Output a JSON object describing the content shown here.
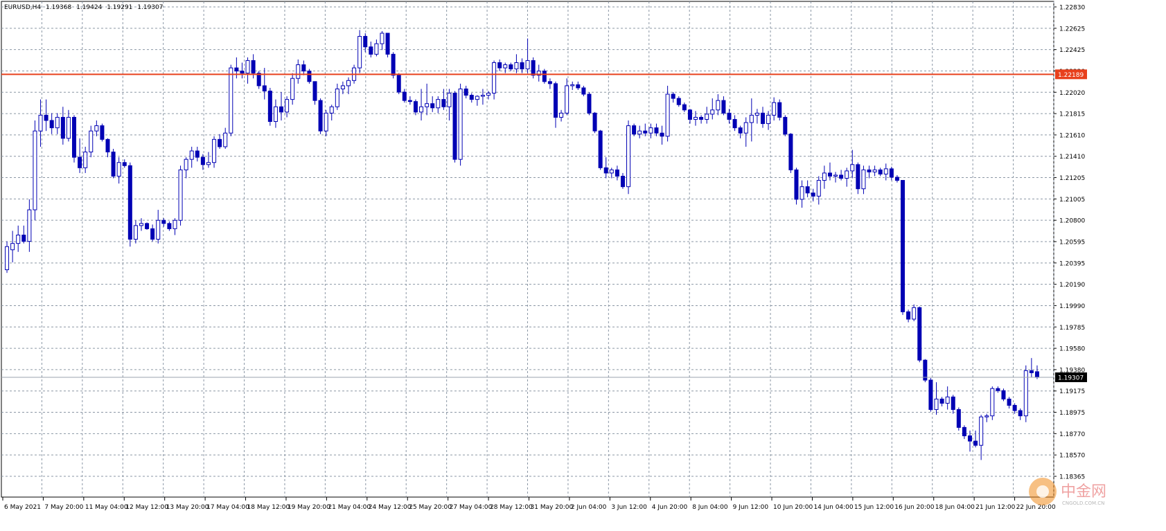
{
  "chart_data": {
    "type": "candlestick",
    "symbol": "EURUSD,H4",
    "ohlc_header": [
      "1.19368",
      "1.19424",
      "1.19291",
      "1.19307"
    ],
    "grid": true,
    "colors": {
      "candle": "#0000b4",
      "grid": "#8a96a4",
      "resistance_line": "#e8401c",
      "current_price_line": "#9aa2ac",
      "label_bg": "#000000",
      "axis_text": "#000000"
    },
    "ylim": [
      1.18365,
      1.2283
    ],
    "y_ticks": [
      "1.22830",
      "1.22625",
      "1.22425",
      "1.22220",
      "1.22020",
      "1.21815",
      "1.21610",
      "1.21410",
      "1.21205",
      "1.21005",
      "1.20800",
      "1.20595",
      "1.20395",
      "1.20190",
      "1.19990",
      "1.19785",
      "1.19580",
      "1.19380",
      "1.19175",
      "1.18975",
      "1.18770",
      "1.18570",
      "1.18365"
    ],
    "x_labels": [
      "6 May 2021",
      "7 May 20:00",
      "11 May 04:00",
      "12 May 12:00",
      "13 May 20:00",
      "17 May 04:00",
      "18 May 12:00",
      "19 May 20:00",
      "21 May 04:00",
      "24 May 12:00",
      "25 May 20:00",
      "27 May 04:00",
      "28 May 12:00",
      "31 May 20:00",
      "2 Jun 04:00",
      "3 Jun 12:00",
      "4 Jun 20:00",
      "8 Jun 04:00",
      "9 Jun 12:00",
      "10 Jun 20:00",
      "14 Jun 04:00",
      "15 Jun 12:00",
      "16 Jun 20:00",
      "18 Jun 04:00",
      "21 Jun 12:00",
      "22 Jun 20:00"
    ],
    "horizontal_line": {
      "price": 1.22189,
      "label": "1.22189"
    },
    "current_price": {
      "price": 1.19307,
      "label": "1.19307"
    },
    "candles": [
      [
        1.2033,
        1.206,
        1.203,
        1.2055
      ],
      [
        1.2052,
        1.207,
        1.204,
        1.2058
      ],
      [
        1.2058,
        1.2075,
        1.205,
        1.2066
      ],
      [
        1.2066,
        1.2075,
        1.2058,
        1.206
      ],
      [
        1.206,
        1.21,
        1.205,
        1.209
      ],
      [
        1.209,
        1.2175,
        1.208,
        1.2165
      ],
      [
        1.2165,
        1.2195,
        1.215,
        1.218
      ],
      [
        1.218,
        1.2195,
        1.2165,
        1.2175
      ],
      [
        1.2175,
        1.2182,
        1.2162,
        1.2168
      ],
      [
        1.2168,
        1.2182,
        1.2162,
        1.2178
      ],
      [
        1.2178,
        1.2188,
        1.2152,
        1.2158
      ],
      [
        1.2158,
        1.2185,
        1.2155,
        1.2178
      ],
      [
        1.2178,
        1.218,
        1.2135,
        1.214
      ],
      [
        1.214,
        1.2158,
        1.2125,
        1.213
      ],
      [
        1.213,
        1.215,
        1.2125,
        1.2145
      ],
      [
        1.2145,
        1.217,
        1.214,
        1.2165
      ],
      [
        1.2165,
        1.2175,
        1.216,
        1.217
      ],
      [
        1.217,
        1.2172,
        1.2155,
        1.2157
      ],
      [
        1.2157,
        1.2158,
        1.214,
        1.2145
      ],
      [
        1.2145,
        1.2148,
        1.212,
        1.2122
      ],
      [
        1.2122,
        1.214,
        1.2115,
        1.2135
      ],
      [
        1.2135,
        1.2138,
        1.213,
        1.2132
      ],
      [
        1.2132,
        1.2135,
        1.2055,
        1.2062
      ],
      [
        1.2062,
        1.208,
        1.2058,
        1.2075
      ],
      [
        1.2075,
        1.2082,
        1.207,
        1.2077
      ],
      [
        1.2077,
        1.2078,
        1.2071,
        1.2072
      ],
      [
        1.2072,
        1.2076,
        1.206,
        1.2062
      ],
      [
        1.2062,
        1.209,
        1.2058,
        1.208
      ],
      [
        1.208,
        1.2082,
        1.2074,
        1.2077
      ],
      [
        1.2077,
        1.2079,
        1.207,
        1.2072
      ],
      [
        1.2072,
        1.2082,
        1.2066,
        1.208
      ],
      [
        1.208,
        1.2132,
        1.2075,
        1.2128
      ],
      [
        1.2128,
        1.214,
        1.212,
        1.2138
      ],
      [
        1.2138,
        1.215,
        1.213,
        1.2146
      ],
      [
        1.2146,
        1.215,
        1.2136,
        1.214
      ],
      [
        1.214,
        1.2143,
        1.2128,
        1.2133
      ],
      [
        1.2133,
        1.2145,
        1.213,
        1.2135
      ],
      [
        1.2135,
        1.216,
        1.213,
        1.2157
      ],
      [
        1.2157,
        1.2162,
        1.2148,
        1.215
      ],
      [
        1.215,
        1.2168,
        1.2148,
        1.2163
      ],
      [
        1.2163,
        1.2228,
        1.216,
        1.2225
      ],
      [
        1.2225,
        1.2235,
        1.2215,
        1.2222
      ],
      [
        1.2222,
        1.223,
        1.2215,
        1.222
      ],
      [
        1.222,
        1.2235,
        1.221,
        1.2232
      ],
      [
        1.2232,
        1.2238,
        1.2215,
        1.222
      ],
      [
        1.222,
        1.2222,
        1.2205,
        1.2208
      ],
      [
        1.2208,
        1.2225,
        1.2195,
        1.2203
      ],
      [
        1.2203,
        1.2206,
        1.217,
        1.2174
      ],
      [
        1.2174,
        1.2195,
        1.2168,
        1.2188
      ],
      [
        1.2188,
        1.2202,
        1.2175,
        1.2183
      ],
      [
        1.2183,
        1.2198,
        1.2178,
        1.2195
      ],
      [
        1.2195,
        1.222,
        1.219,
        1.2215
      ],
      [
        1.2215,
        1.2233,
        1.221,
        1.2228
      ],
      [
        1.2228,
        1.2232,
        1.2218,
        1.2222
      ],
      [
        1.2222,
        1.2224,
        1.221,
        1.2212
      ],
      [
        1.2212,
        1.2212,
        1.219,
        1.2194
      ],
      [
        1.2194,
        1.2196,
        1.2162,
        1.2165
      ],
      [
        1.2165,
        1.2185,
        1.216,
        1.2182
      ],
      [
        1.2182,
        1.219,
        1.2175,
        1.2188
      ],
      [
        1.2188,
        1.221,
        1.2185,
        1.2205
      ],
      [
        1.2205,
        1.2212,
        1.22,
        1.2208
      ],
      [
        1.2208,
        1.2216,
        1.22,
        1.2213
      ],
      [
        1.2213,
        1.2228,
        1.221,
        1.2225
      ],
      [
        1.2225,
        1.2261,
        1.222,
        1.2255
      ],
      [
        1.2255,
        1.2258,
        1.224,
        1.2245
      ],
      [
        1.2245,
        1.225,
        1.2235,
        1.2238
      ],
      [
        1.2238,
        1.2252,
        1.2236,
        1.2248
      ],
      [
        1.2248,
        1.226,
        1.2242,
        1.2258
      ],
      [
        1.2258,
        1.2258,
        1.2235,
        1.2238
      ],
      [
        1.2238,
        1.224,
        1.2215,
        1.2218
      ],
      [
        1.2218,
        1.222,
        1.22,
        1.2202
      ],
      [
        1.2202,
        1.2205,
        1.2192,
        1.2194
      ],
      [
        1.2194,
        1.2198,
        1.219,
        1.2193
      ],
      [
        1.2193,
        1.2195,
        1.218,
        1.2183
      ],
      [
        1.2183,
        1.2205,
        1.2175,
        1.2188
      ],
      [
        1.2188,
        1.221,
        1.218,
        1.2191
      ],
      [
        1.2191,
        1.2198,
        1.2183,
        1.2187
      ],
      [
        1.2187,
        1.2198,
        1.2182,
        1.2195
      ],
      [
        1.2195,
        1.2205,
        1.2185,
        1.2188
      ],
      [
        1.2188,
        1.2205,
        1.2175,
        1.2201
      ],
      [
        1.2201,
        1.2203,
        1.2135,
        1.2138
      ],
      [
        1.2138,
        1.221,
        1.2132,
        1.2205
      ],
      [
        1.2205,
        1.2208,
        1.2196,
        1.2199
      ],
      [
        1.2199,
        1.2201,
        1.2192,
        1.2195
      ],
      [
        1.2195,
        1.2199,
        1.2189,
        1.2198
      ],
      [
        1.2198,
        1.2205,
        1.219,
        1.2199
      ],
      [
        1.2199,
        1.2203,
        1.2195,
        1.2201
      ],
      [
        1.2201,
        1.2232,
        1.2195,
        1.223
      ],
      [
        1.223,
        1.2233,
        1.2222,
        1.2225
      ],
      [
        1.2225,
        1.223,
        1.222,
        1.2228
      ],
      [
        1.2228,
        1.223,
        1.2222,
        1.2224
      ],
      [
        1.2224,
        1.2238,
        1.222,
        1.223
      ],
      [
        1.223,
        1.2234,
        1.222,
        1.2224
      ],
      [
        1.2224,
        1.2253,
        1.222,
        1.2232
      ],
      [
        1.2232,
        1.2235,
        1.2215,
        1.2218
      ],
      [
        1.2218,
        1.2228,
        1.2212,
        1.2222
      ],
      [
        1.2222,
        1.2224,
        1.221,
        1.2212
      ],
      [
        1.2212,
        1.2215,
        1.2205,
        1.221
      ],
      [
        1.221,
        1.2212,
        1.2168,
        1.2178
      ],
      [
        1.2178,
        1.2185,
        1.2174,
        1.2182
      ],
      [
        1.2182,
        1.2215,
        1.218,
        1.2208
      ],
      [
        1.2208,
        1.2212,
        1.2204,
        1.2209
      ],
      [
        1.2209,
        1.2212,
        1.2204,
        1.2206
      ],
      [
        1.2206,
        1.2208,
        1.2198,
        1.22
      ],
      [
        1.22,
        1.2202,
        1.218,
        1.2182
      ],
      [
        1.2182,
        1.2183,
        1.2163,
        1.2165
      ],
      [
        1.2165,
        1.2166,
        1.2128,
        1.213
      ],
      [
        1.213,
        1.214,
        1.212,
        1.2125
      ],
      [
        1.2125,
        1.213,
        1.212,
        1.2128
      ],
      [
        1.2128,
        1.2132,
        1.2118,
        1.2122
      ],
      [
        1.2122,
        1.2125,
        1.211,
        1.2112
      ],
      [
        1.2112,
        1.2175,
        1.2105,
        1.217
      ],
      [
        1.217,
        1.2172,
        1.216,
        1.2162
      ],
      [
        1.2162,
        1.217,
        1.2158,
        1.2165
      ],
      [
        1.2165,
        1.2172,
        1.216,
        1.2163
      ],
      [
        1.2163,
        1.2172,
        1.2158,
        1.2168
      ],
      [
        1.2168,
        1.2172,
        1.216,
        1.2163
      ],
      [
        1.2163,
        1.217,
        1.2152,
        1.216
      ],
      [
        1.216,
        1.2208,
        1.2155,
        1.22
      ],
      [
        1.22,
        1.2202,
        1.2192,
        1.2196
      ],
      [
        1.2196,
        1.2198,
        1.2188,
        1.219
      ],
      [
        1.219,
        1.2192,
        1.2183,
        1.2185
      ],
      [
        1.2185,
        1.2186,
        1.2172,
        1.2176
      ],
      [
        1.2176,
        1.2184,
        1.217,
        1.2178
      ],
      [
        1.2178,
        1.218,
        1.2172,
        1.2176
      ],
      [
        1.2176,
        1.2188,
        1.2172,
        1.2181
      ],
      [
        1.2181,
        1.2196,
        1.2176,
        1.2185
      ],
      [
        1.2185,
        1.22,
        1.218,
        1.2194
      ],
      [
        1.2194,
        1.2198,
        1.218,
        1.2182
      ],
      [
        1.2182,
        1.2186,
        1.2172,
        1.2176
      ],
      [
        1.2176,
        1.218,
        1.2165,
        1.2168
      ],
      [
        1.2168,
        1.217,
        1.2158,
        1.2163
      ],
      [
        1.2163,
        1.2178,
        1.215,
        1.2173
      ],
      [
        1.2173,
        1.2196,
        1.2155,
        1.218
      ],
      [
        1.218,
        1.2186,
        1.2172,
        1.2182
      ],
      [
        1.2182,
        1.2188,
        1.2168,
        1.2172
      ],
      [
        1.2172,
        1.2184,
        1.2166,
        1.218
      ],
      [
        1.218,
        1.2197,
        1.2175,
        1.2192
      ],
      [
        1.2192,
        1.2195,
        1.2175,
        1.2178
      ],
      [
        1.2178,
        1.218,
        1.216,
        1.2162
      ],
      [
        1.2162,
        1.2163,
        1.2125,
        1.2128
      ],
      [
        1.2128,
        1.213,
        1.2095,
        1.21
      ],
      [
        1.21,
        1.2118,
        1.2092,
        1.2112
      ],
      [
        1.2112,
        1.2118,
        1.2102,
        1.2106
      ],
      [
        1.2106,
        1.211,
        1.2098,
        1.2103
      ],
      [
        1.2103,
        1.2122,
        1.2095,
        1.2118
      ],
      [
        1.2118,
        1.2132,
        1.211,
        1.2125
      ],
      [
        1.2125,
        1.2135,
        1.2118,
        1.2122
      ],
      [
        1.2122,
        1.2126,
        1.2116,
        1.2123
      ],
      [
        1.2123,
        1.2128,
        1.2118,
        1.212
      ],
      [
        1.212,
        1.213,
        1.2112,
        1.2127
      ],
      [
        1.2127,
        1.2147,
        1.212,
        1.2133
      ],
      [
        1.2133,
        1.2135,
        1.2105,
        1.211
      ],
      [
        1.211,
        1.2132,
        1.2105,
        1.2128
      ],
      [
        1.2128,
        1.2132,
        1.212,
        1.2126
      ],
      [
        1.2126,
        1.2132,
        1.2122,
        1.2128
      ],
      [
        1.2128,
        1.213,
        1.2122,
        1.2124
      ],
      [
        1.2124,
        1.2134,
        1.2118,
        1.2129
      ],
      [
        1.2129,
        1.2131,
        1.2118,
        1.2121
      ],
      [
        1.2121,
        1.2123,
        1.2116,
        1.2118
      ],
      [
        1.2118,
        1.2118,
        1.199,
        1.1993
      ],
      [
        1.1993,
        1.1995,
        1.1983,
        1.1986
      ],
      [
        1.1986,
        1.2,
        1.1984,
        1.1997
      ],
      [
        1.1997,
        1.1998,
        1.1945,
        1.1947
      ],
      [
        1.1947,
        1.1948,
        1.1926,
        1.1928
      ],
      [
        1.1928,
        1.193,
        1.1898,
        1.19
      ],
      [
        1.19,
        1.1926,
        1.1895,
        1.191
      ],
      [
        1.191,
        1.1912,
        1.1903,
        1.1906
      ],
      [
        1.1906,
        1.1922,
        1.19,
        1.1912
      ],
      [
        1.1912,
        1.1914,
        1.1896,
        1.19
      ],
      [
        1.19,
        1.1902,
        1.188,
        1.1883
      ],
      [
        1.1883,
        1.1885,
        1.1872,
        1.1875
      ],
      [
        1.1875,
        1.188,
        1.186,
        1.187
      ],
      [
        1.187,
        1.188,
        1.1864,
        1.1866
      ],
      [
        1.1866,
        1.1895,
        1.1852,
        1.1893
      ],
      [
        1.1893,
        1.1896,
        1.1888,
        1.1894
      ],
      [
        1.1894,
        1.1922,
        1.189,
        1.192
      ],
      [
        1.192,
        1.1922,
        1.1916,
        1.1918
      ],
      [
        1.1918,
        1.192,
        1.1908,
        1.191
      ],
      [
        1.191,
        1.1912,
        1.1901,
        1.1904
      ],
      [
        1.1904,
        1.1906,
        1.1896,
        1.1899
      ],
      [
        1.1899,
        1.1901,
        1.189,
        1.1894
      ],
      [
        1.1894,
        1.1942,
        1.1888,
        1.1937
      ],
      [
        1.1937,
        1.1949,
        1.1931,
        1.1935
      ],
      [
        1.1936,
        1.1942,
        1.1929,
        1.1931
      ]
    ]
  }
}
